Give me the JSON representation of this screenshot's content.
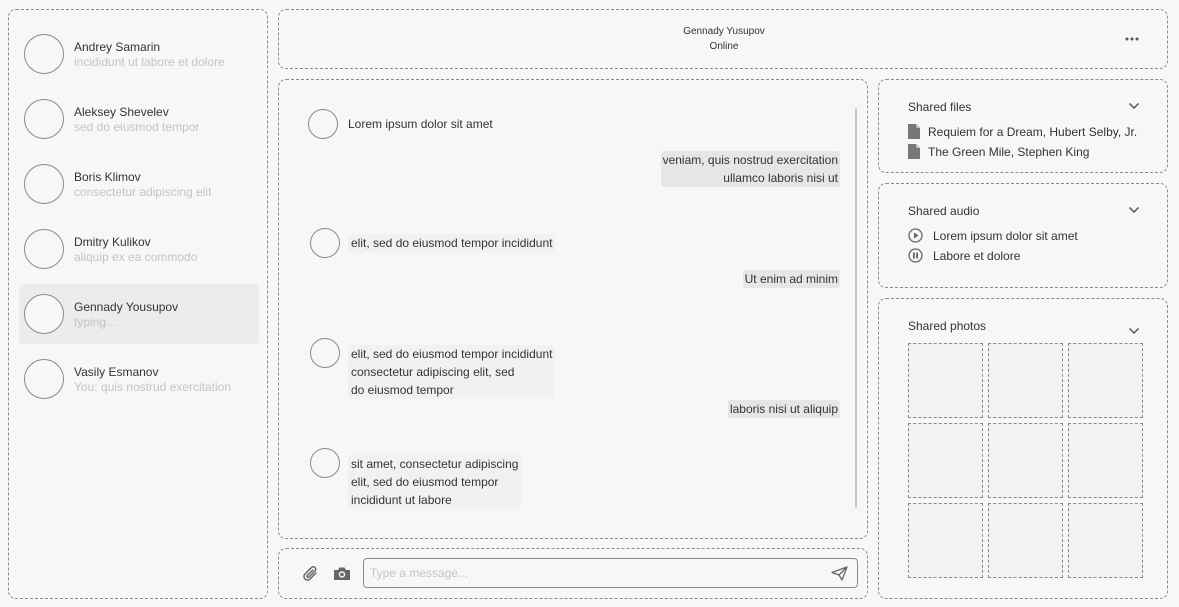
{
  "contacts": [
    {
      "name": "Andrey Samarin",
      "preview": "incididunt ut labore et dolore"
    },
    {
      "name": "Aleksey Shevelev",
      "preview": "sed do eiusmod tempor"
    },
    {
      "name": "Boris Klimov",
      "preview": "consectetur adipiscing elit"
    },
    {
      "name": "Dmitry Kulikov",
      "preview": "aliquip ex ea commodo"
    },
    {
      "name": "Gennady Yousupov",
      "preview": "typing..."
    },
    {
      "name": "Vasily Esmanov",
      "preview": "You: quis nostrud exercitation"
    }
  ],
  "header": {
    "name": "Gennady Yusupov",
    "status": "Online",
    "more_icon": "more-horizontal-icon"
  },
  "messages": [
    {
      "dir": "in",
      "lines": [
        "Lorem ipsum dolor sit amet"
      ]
    },
    {
      "dir": "out",
      "lines": [
        "veniam, quis nostrud exercitation",
        "ullamco laboris nisi ut"
      ]
    },
    {
      "dir": "in",
      "lines": [
        "elit, sed do eiusmod tempor incididunt"
      ]
    },
    {
      "dir": "out",
      "lines": [
        "Ut enim ad minim"
      ]
    },
    {
      "dir": "in",
      "lines": [
        "elit, sed do eiusmod tempor incididunt",
        "consectetur adipiscing elit, sed",
        "do eiusmod tempor"
      ]
    },
    {
      "dir": "out",
      "lines": [
        "laboris nisi ut aliquip"
      ]
    },
    {
      "dir": "in",
      "lines": [
        "sit amet, consectetur adipiscing",
        "elit, sed do eiusmod tempor",
        "incididunt ut labore"
      ]
    }
  ],
  "composer": {
    "placeholder": "Type a message...",
    "attach_icon": "paperclip-icon",
    "camera_icon": "camera-icon",
    "send_icon": "send-icon"
  },
  "shared_files": {
    "title": "Shared files",
    "items": [
      {
        "label": "Requiem for a Dream, Hubert Selby, Jr.",
        "icon": "file-icon"
      },
      {
        "label": "The Green Mile, Stephen King",
        "icon": "file-icon"
      }
    ]
  },
  "shared_audio": {
    "title": "Shared audio",
    "items": [
      {
        "label": "Lorem ipsum dolor sit amet",
        "icon": "play-icon"
      },
      {
        "label": "Labore et dolore",
        "icon": "pause-icon"
      }
    ]
  },
  "shared_photos": {
    "title": "Shared photos",
    "count": 9
  },
  "colors": {
    "background": "#f7f7f7",
    "border": "#8a8a8a",
    "muted_text": "#c4c4c4",
    "active_contact": "#ececec"
  }
}
